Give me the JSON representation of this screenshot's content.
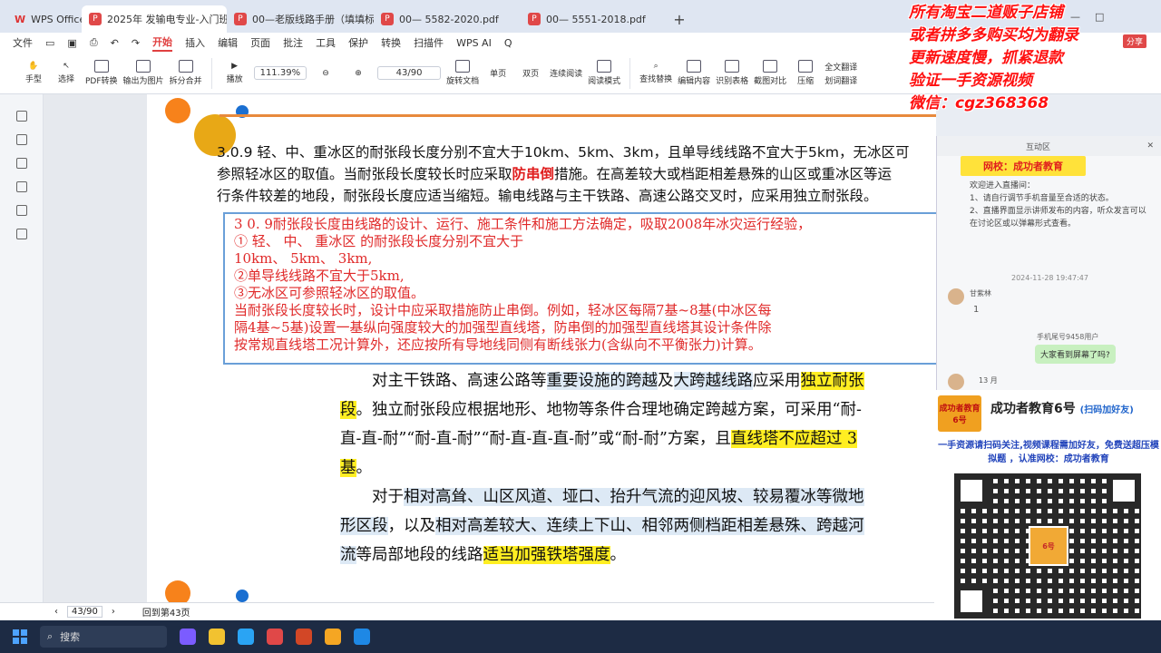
{
  "tabs": [
    {
      "label": "WPS Office",
      "active": false
    },
    {
      "label": "2025年 发输电专业-入门班-恶",
      "active": true
    },
    {
      "label": "00—老版线路手册（填填标注版）.p",
      "active": false
    },
    {
      "label": "00— 5582-2020.pdf",
      "active": false
    },
    {
      "label": "00— 5551-2018.pdf",
      "active": false
    }
  ],
  "menu": {
    "file": "文件",
    "items": [
      "开始",
      "插入",
      "编辑",
      "页面",
      "批注",
      "工具",
      "保护",
      "转换",
      "扫描件",
      "WPS AI",
      "Q"
    ]
  },
  "ribbon": {
    "hand": "手型",
    "select": "选择",
    "pdf_convert": "PDF转换",
    "export_image": "输出为图片",
    "split_merge": "拆分合并",
    "play": "播放",
    "zoom": "111.39%",
    "page_box": "43/90",
    "rotate": "旋转文档",
    "single": "单页",
    "double": "双页",
    "continuous": "连续阅读",
    "reading_mode": "阅读模式",
    "find_replace": "查找替换",
    "edit_content": "编辑内容",
    "recognize_table": "识别表格",
    "screenshot_compare": "截图对比",
    "compress": "压缩",
    "full_translate": "全文翻译",
    "word_translate": "划词翻译"
  },
  "document": {
    "para1_a": "3.0.9  轻、中、重冰区的耐张段长度分别不宜大于10km、5km、3km，且单导线线路不宜大于5km，无冰区可",
    "para1_b": "参照轻冰区的取值。当耐张段长度较长时应采取",
    "para1_red": "防串倒",
    "para1_c": "措施。在高差较大或档距相差悬殊的山区或重冰区等运",
    "para1_d": "行条件较差的地段，耐张段长度应适当缩短。输电线路与主干铁路、高速公路交叉时，应采用独立耐张段。",
    "redbox": [
      "3  0. 9耐张段长度由线路的设计、运行、施工条件和施工方法确定，吸取2008年冰灾运行经验，",
      "        ①    轻、      中、        重冰区      的耐张段长度分别不宜大于",
      "              10km、          5km、        3km,",
      "        ②单导线线路不宜大于5km,",
      "        ③无冰区可参照轻冰区的取值。",
      "当耐张段长度较长时，设计中应采取措施防止串倒。例如，轻冰区每隔7基~8基(中冰区每",
      "隔4基~5基)设置一基纵向强度较大的加强型直线塔，防串倒的加强型直线塔其设计条件除",
      "按常规直线塔工况计算外，还应按所有导地线同侧有断线张力(含纵向不平衡张力)计算。"
    ],
    "p2_s1": "对主干铁路、高速公路等",
    "p2_s2": "重要设施的跨越",
    "p2_s3": "及",
    "p2_s4": "大跨越线路",
    "p2_s5": "应采用",
    "p2_s6": "独立耐张段",
    "p2_s7": "。独立耐张段应根据地形、地物等条件合理地确定跨越方案，可采用“耐-直-直-耐”“耐-直-耐”“耐-直-直-直-耐”或“耐-耐”方案，且",
    "p2_s8": "直线塔不应超过 3 基",
    "p2_s9": "。",
    "p3_s1": "对于",
    "p3_s2": "相对高耸、山区风道、垭口、抬升气流的迎风坡、较易覆冰等微地形区段",
    "p3_s3": "，以及",
    "p3_s4": "相对高差较大、连续上下山、相邻两侧档距相差悬殊、跨越河流",
    "p3_s5": "等局部地段的线路",
    "p3_s6": "适当加强铁塔强度",
    "p3_s7": "。"
  },
  "statusbar": {
    "page": "43/90",
    "back": "回到第43页"
  },
  "taskbar": {
    "search": "搜索"
  },
  "chat": {
    "header": "互动区",
    "school": "网校：成功者教育",
    "welcome": "欢迎进入直播间：\n1、请自行调节手机音量至合适的状态。\n2、直播界面显示讲师发布的内容，听众发言可以在讨论区或以弹幕形式查看。",
    "time": "2024-11-28 19:47:47",
    "user1": "甘紫林",
    "count": "1",
    "user2": "手机尾号9458用户",
    "bubble": "大家看到屏幕了吗?",
    "user3": "13 月"
  },
  "ad": {
    "title": "成功者教育6号",
    "title_sub": "(扫码加好友)",
    "logo_text": "成功者教育 6号",
    "desc": "一手资源请扫码关注,视频课程需加好友，免费送超压模拟题 ，认准网校：成功者教育"
  },
  "overlay": [
    "所有淘宝二道贩子店铺",
    "或者拼多多购买均为翻录",
    "更新速度慢，抓紧退款",
    "验证一手资源视频",
    "微信：cgz368368"
  ],
  "share": "分享",
  "colors": {
    "accent": "#e04040",
    "highlight_yellow": "#ffee22",
    "highlight_blue": "#dde9f5",
    "overlay_red": "#ff1010"
  }
}
